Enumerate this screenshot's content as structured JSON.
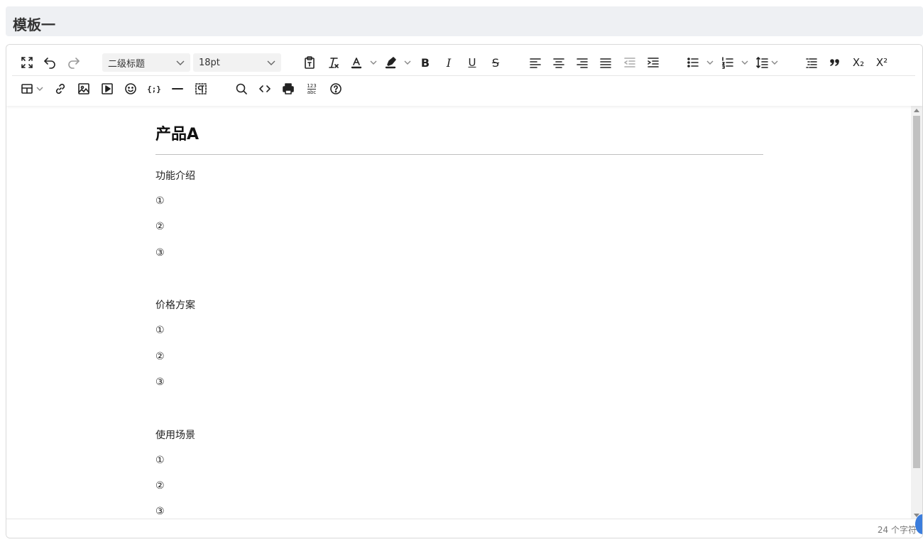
{
  "page": {
    "title": "模板一"
  },
  "toolbar": {
    "heading_select": "二级标题",
    "font_size_select": "18pt",
    "bold": "B",
    "italic": "I",
    "underline": "U",
    "strikethrough": "S",
    "subscript": "X₂",
    "superscript": "X²",
    "codesample": "{;}",
    "spellcheck_top": "123",
    "spellcheck_bottom": "abc"
  },
  "document": {
    "heading": "产品A",
    "sections": [
      {
        "title": "功能介绍",
        "items": [
          "①",
          "②",
          "③"
        ]
      },
      {
        "title": "价格方案",
        "items": [
          "①",
          "②",
          "③"
        ]
      },
      {
        "title": "使用场景",
        "items": [
          "①",
          "②",
          "③"
        ]
      }
    ]
  },
  "status": {
    "word_count": "24 个字符"
  }
}
